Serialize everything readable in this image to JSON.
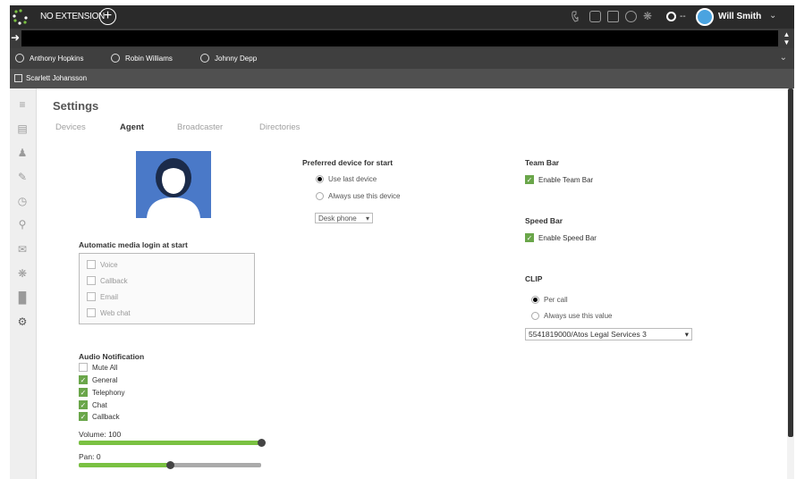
{
  "topbar": {
    "extension_label": "NO EXTENSION",
    "user_name": "Will Smith",
    "presence_text": "--",
    "icons": [
      "phone-icon",
      "voicemail-icon",
      "mail-icon",
      "smiley-icon",
      "team-icon",
      "presence-icon"
    ]
  },
  "teamrow": {
    "members": [
      "Anthony Hopkins",
      "Robin Williams",
      "Johnny Depp"
    ]
  },
  "contactrow": {
    "name": "Scarlett Johansson"
  },
  "settings": {
    "title": "Settings",
    "tabs": [
      "Devices",
      "Agent",
      "Broadcaster",
      "Directories"
    ],
    "active_tab": "Agent",
    "media_login": {
      "label": "Automatic media login at start",
      "options": [
        "Voice",
        "Callback",
        "Email",
        "Web chat"
      ]
    },
    "audio": {
      "label": "Audio Notification",
      "items": [
        {
          "label": "Mute All",
          "checked": false
        },
        {
          "label": "General",
          "checked": true
        },
        {
          "label": "Telephony",
          "checked": true
        },
        {
          "label": "Chat",
          "checked": true
        },
        {
          "label": "Callback",
          "checked": true
        }
      ],
      "volume_label": "Volume: 100",
      "volume_value": 100,
      "pan_label": "Pan: 0",
      "pan_value": 0
    },
    "device": {
      "label": "Preferred device for start",
      "opt1": "Use last device",
      "opt2": "Always use this device",
      "selected_device": "Desk phone"
    },
    "team_bar": {
      "label": "Team Bar",
      "check": "Enable Team Bar"
    },
    "speed_bar": {
      "label": "Speed Bar",
      "check": "Enable Speed Bar"
    },
    "clip": {
      "label": "CLIP",
      "opt1": "Per call",
      "opt2": "Always use this value",
      "selected": "5541819000/Atos Legal Services 3"
    }
  },
  "colors": {
    "accent": "#7ac142",
    "checkbox": "#6aa64a",
    "avatar": "#4a79c8"
  }
}
